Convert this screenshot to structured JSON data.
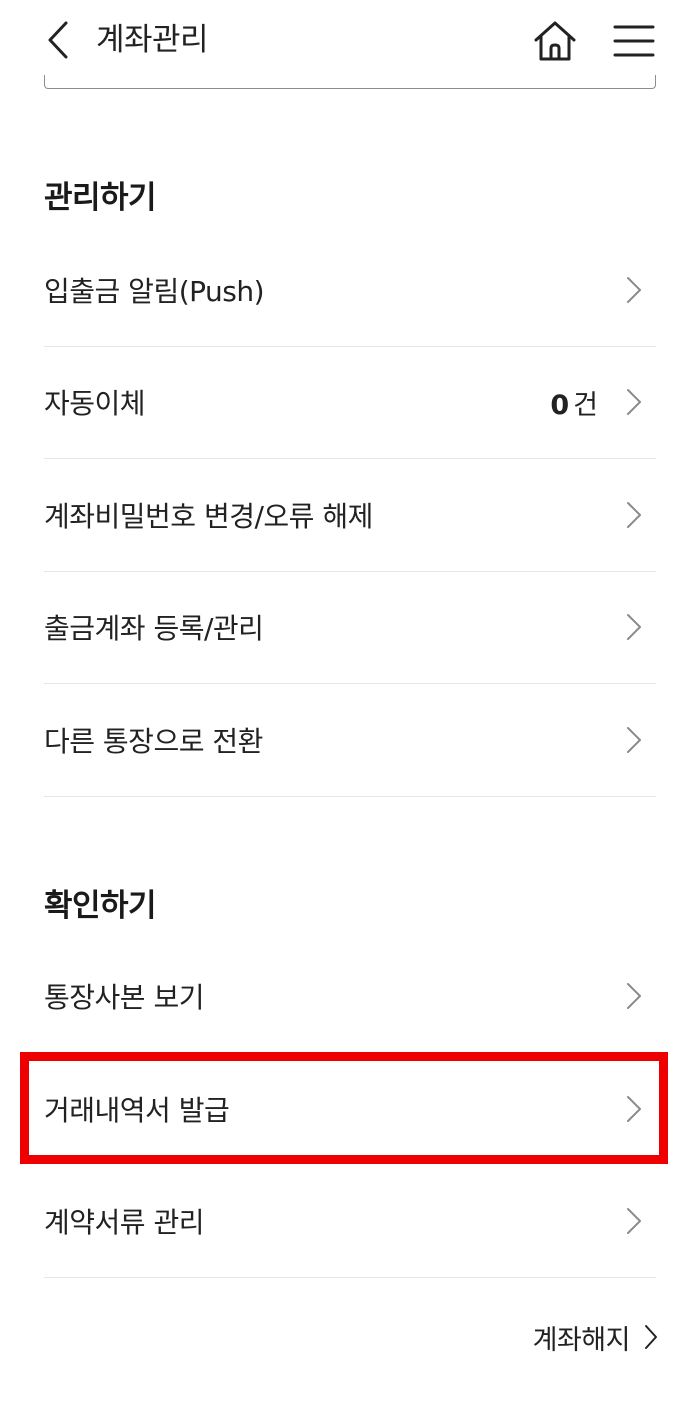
{
  "header": {
    "title": "계좌관리",
    "icons": {
      "back": "chevron-left-icon",
      "home": "home-icon",
      "menu": "hamburger-menu-icon"
    }
  },
  "sections": {
    "manage": {
      "title": "관리하기",
      "items": [
        {
          "label": "입출금 알림(Push)"
        },
        {
          "label": "자동이체",
          "count": "0",
          "count_unit": "건"
        },
        {
          "label": "계좌비밀번호 변경/오류 해제"
        },
        {
          "label": "출금계좌 등록/관리"
        },
        {
          "label": "다른 통장으로 전환"
        }
      ]
    },
    "check": {
      "title": "확인하기",
      "items": [
        {
          "label": "통장사본 보기"
        },
        {
          "label": "거래내역서 발급"
        },
        {
          "label": "계약서류 관리"
        }
      ]
    }
  },
  "footer": {
    "close_account_label": "계좌해지"
  },
  "colors": {
    "highlight": "#ee0000",
    "divider": "#e6e6e6",
    "text": "#222222",
    "chevron": "#8a8a8a"
  }
}
